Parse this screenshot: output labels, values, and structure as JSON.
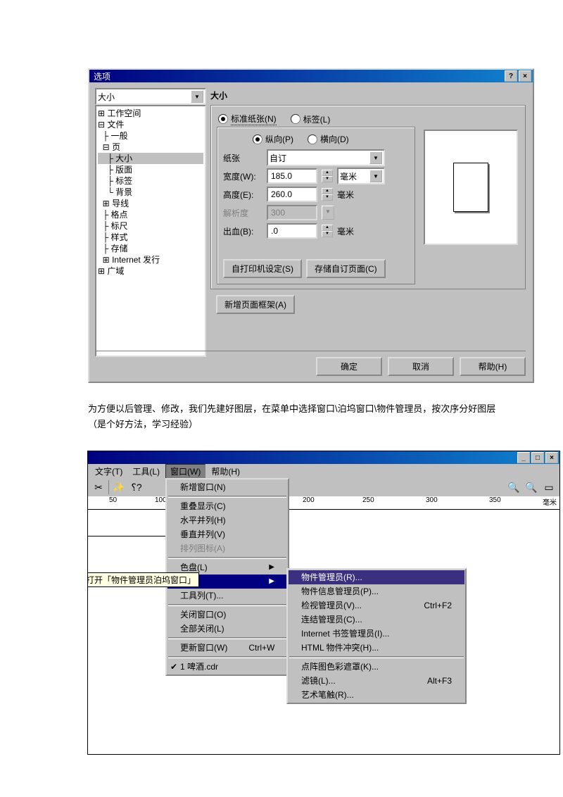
{
  "dialog": {
    "title": "选项",
    "combo_value": "大小",
    "panel_title": "大小",
    "tree": {
      "workspace": "工作空间",
      "file": "文件",
      "general": "一般",
      "page": "页",
      "size": "大小",
      "layout": "版面",
      "label": "标签",
      "background": "背景",
      "guides": "导线",
      "grid": "格点",
      "ruler": "标尺",
      "style": "样式",
      "save": "存储",
      "internet": "Internet 发行",
      "global": "广域"
    },
    "radios": {
      "std_paper": "标准纸张(N)",
      "labels": "标签(L)",
      "portrait": "纵向(P)",
      "landscape": "横向(D)"
    },
    "fields": {
      "paper_label": "纸张",
      "paper_value": "自订",
      "width_label": "宽度(W):",
      "width_value": "185.0",
      "height_label": "高度(E):",
      "height_value": "260.0",
      "res_label": "解析度",
      "res_value": "300",
      "bleed_label": "出血(B):",
      "bleed_value": ".0",
      "unit_mm": "毫米"
    },
    "buttons": {
      "printer_setup": "自打印机设定(S)",
      "save_page": "存储自订页面(C)",
      "new_frame": "新增页面框架(A)",
      "ok": "确定",
      "cancel": "取消",
      "help": "帮助(H)"
    }
  },
  "doc_text": {
    "line1": "为方便以后管理、修改，我们先建好图层，在菜单中选择窗口\\泊坞窗口\\物件管理员，按次序分好图层",
    "line2": "（是个好方法，学习经验）"
  },
  "app": {
    "menubar": {
      "text": "文字(T)",
      "tools": "工具(L)",
      "window": "窗口(W)",
      "help": "帮助(H)"
    },
    "ruler_numbers": [
      "50",
      "100",
      "200",
      "250",
      "300",
      "350"
    ],
    "ruler_unit": "毫米",
    "tooltip": "打开「物件管理员泊坞窗口」",
    "win_control": {
      "min": "_",
      "max": "□",
      "close": "×"
    },
    "menu1": {
      "new_window": "新增窗口(N)",
      "cascade": "重叠显示(C)",
      "tile_h": "水平并列(H)",
      "tile_v": "垂直并列(V)",
      "arrange_icons": "排列图标(A)",
      "palette": "色盘(L)",
      "toolbars": "工具列(T)...",
      "close_window": "关闭窗口(O)",
      "close_all": "全部关闭(L)",
      "refresh": "更新窗口(W)",
      "refresh_shortcut": "Ctrl+W",
      "doc1": "1 啤酒.cdr"
    },
    "menu2": {
      "obj_manager": "物件管理员(R)...",
      "obj_info": "物件信息管理员(P)...",
      "view_mgr": "检视管理员(V)...",
      "view_shortcut": "Ctrl+F2",
      "link_mgr": "连结管理员(C)...",
      "bookmark": "Internet 书签管理员(I)...",
      "html_conflict": "HTML 物件冲突(H)...",
      "bitmap_mask": "点阵图色彩遮罩(K)...",
      "lens": "滤镜(L)...",
      "lens_shortcut": "Alt+F3",
      "art_brush": "艺术笔触(R)..."
    }
  }
}
